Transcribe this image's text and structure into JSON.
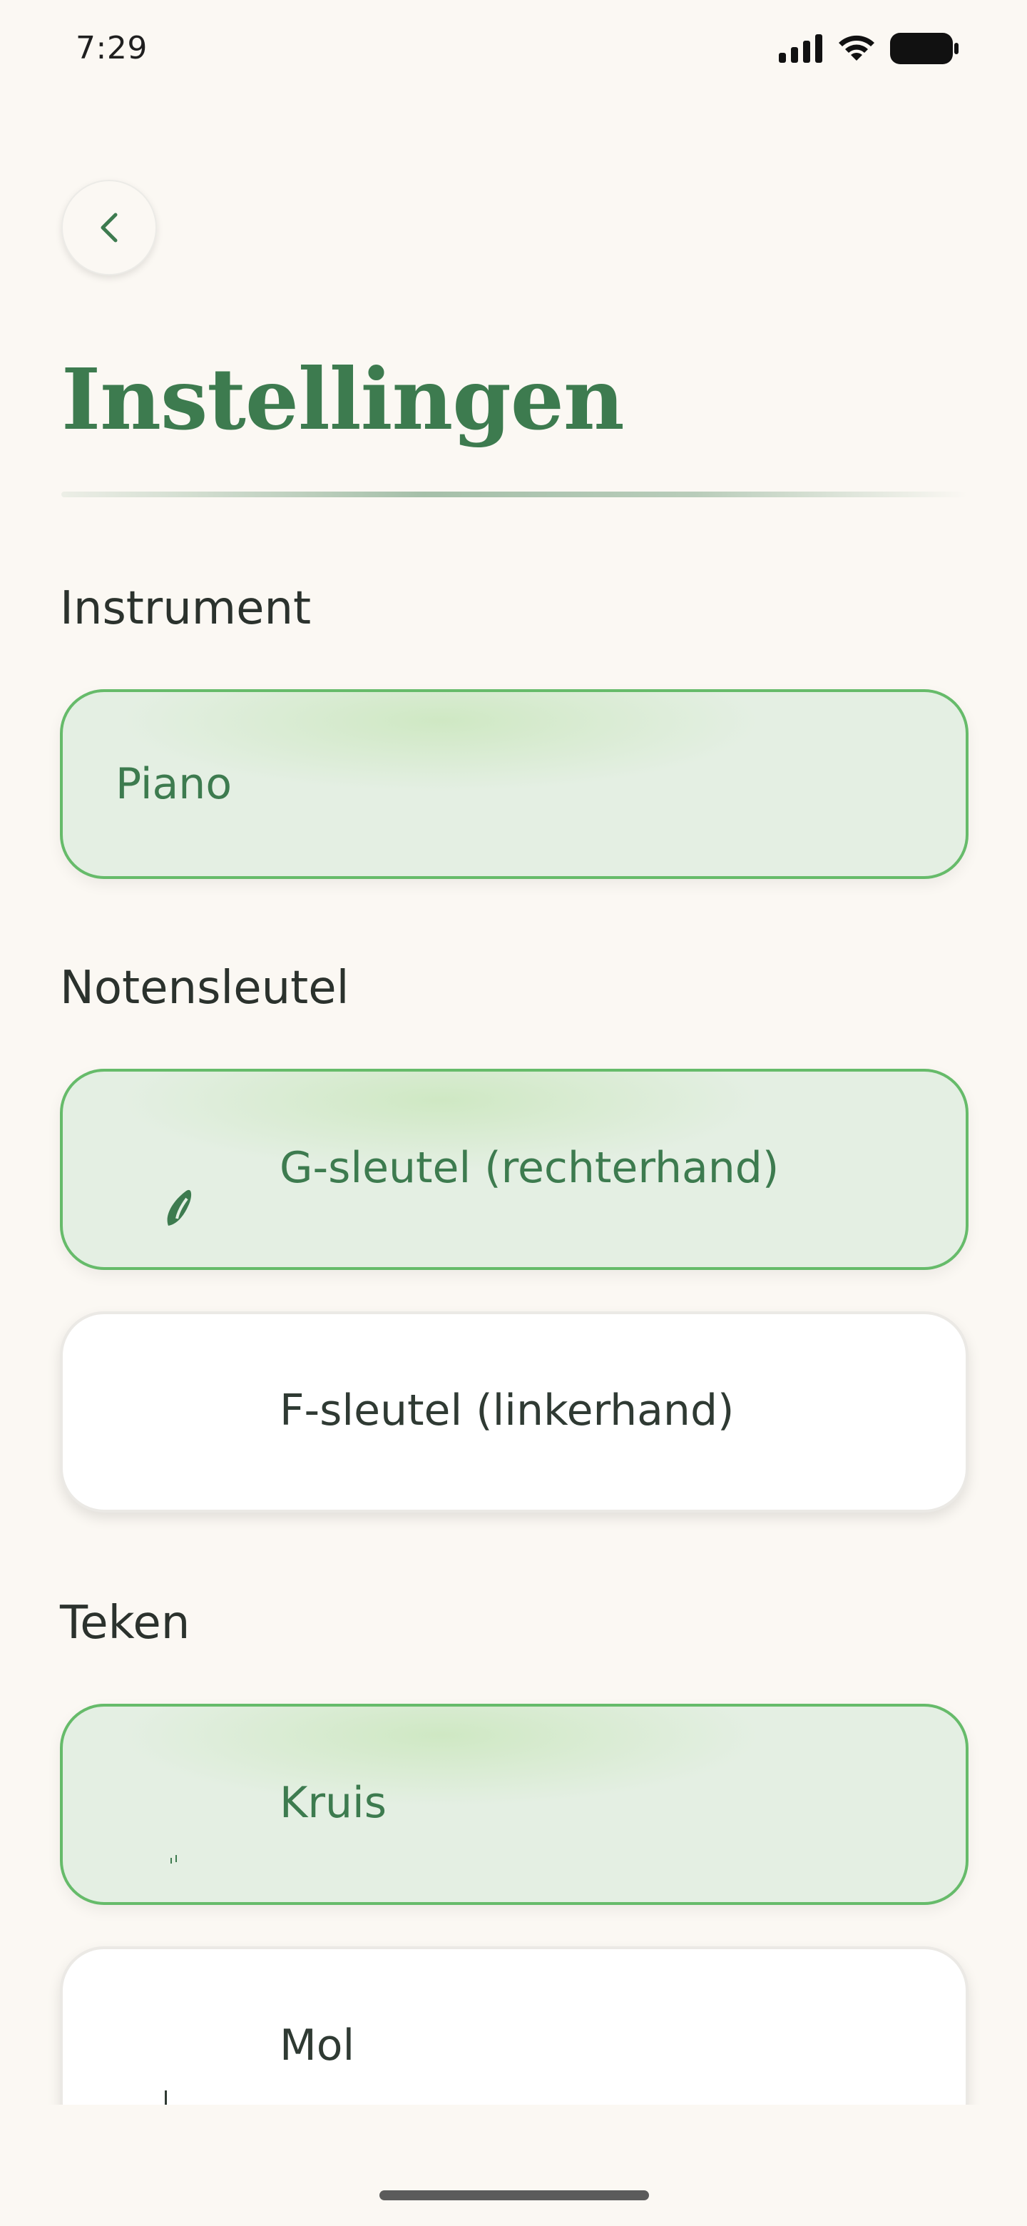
{
  "status_bar": {
    "time": "7:29",
    "icons": [
      "cellular-signal-icon",
      "wifi-icon",
      "battery-icon"
    ]
  },
  "header": {
    "back_icon": "chevron-left-icon",
    "title": "Instellingen"
  },
  "sections": {
    "instrument": {
      "label": "Instrument",
      "options": [
        {
          "label": "Piano",
          "selected": true
        }
      ]
    },
    "clef": {
      "label": "Notensleutel",
      "options": [
        {
          "label": "G-sleutel (rechterhand)",
          "icon": "treble-clef-icon",
          "selected": true
        },
        {
          "label": "F-sleutel (linkerhand)",
          "icon": "bass-clef-icon",
          "selected": false
        }
      ]
    },
    "accidental": {
      "label": "Teken",
      "options": [
        {
          "label": "Kruis",
          "icon": "sharp-icon",
          "selected": true
        },
        {
          "label": "Mol",
          "icon": "flat-icon",
          "selected": false
        }
      ]
    }
  },
  "colors": {
    "background": "#fbf8f3",
    "accent": "#3d7b4f",
    "selected_border": "#66bb6a",
    "selected_fill": "#e4efe3"
  }
}
